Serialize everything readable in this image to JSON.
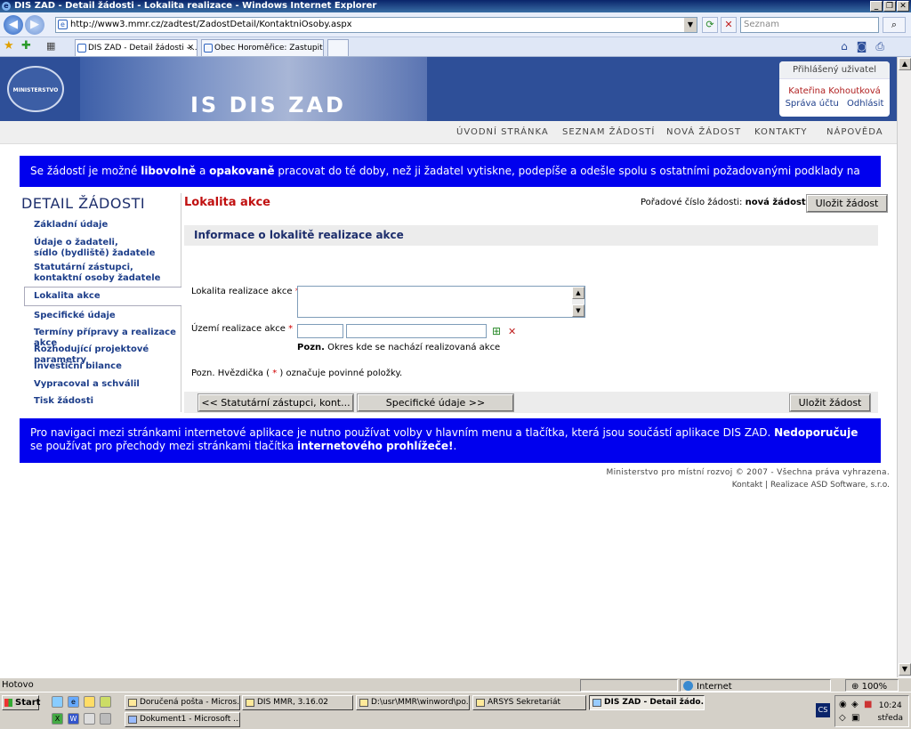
{
  "window": {
    "title": "DIS ZAD - Detail žádosti - Lokalita realizace - Windows Internet Explorer",
    "ie_icon": "e"
  },
  "browser": {
    "url": "http://www3.mmr.cz/zadtest/ZadostDetail/KontaktniOsoby.aspx",
    "search_placeholder": "Seznam",
    "tabs": [
      {
        "label": "DIS ZAD - Detail žádosti -..."
      },
      {
        "label": "Obec Horoměřice: Zastupitel..."
      }
    ],
    "back_glyph": "◀",
    "forward_glyph": "▶",
    "status_left": "Hotovo",
    "status_zone": "Internet",
    "zoom": "100%"
  },
  "header": {
    "seal_text": "MINISTERSTVO PRO MÍSTNÍ ROZVOJ",
    "app_title": "IS DIS ZAD",
    "user_box_title": "Přihlášený uživatel",
    "user_name": "Kateřina Kohoutková",
    "account_link": "Správa účtu",
    "logout_link": "Odhlásit"
  },
  "topnav": [
    "ÚVODNÍ STRÁNKA",
    "SEZNAM ŽÁDOSTÍ",
    "NOVÁ ŽÁDOST",
    "KONTAKTY",
    "NÁPOVĚDA"
  ],
  "info_top": {
    "t1": "Se žádostí je možné ",
    "b1": "libovolně",
    "t2": " a ",
    "b2": "opakovaně",
    "t3": " pracovat do té doby, než ji žadatel vytiskne, podepíše a odešle spolu s ostatními požadovanými podklady na MMR."
  },
  "leftmenu": {
    "title": "DETAIL ŽÁDOSTI",
    "items": [
      {
        "line1": "Základní údaje",
        "line2": ""
      },
      {
        "line1": "Údaje o žadateli,",
        "line2": "sídlo (bydliště) žadatele"
      },
      {
        "line1": "Statutární zástupci,",
        "line2": "kontaktní osoby žadatele"
      },
      {
        "line1": "Lokalita akce",
        "line2": ""
      },
      {
        "line1": "Specifické údaje",
        "line2": ""
      },
      {
        "line1": "Termíny přípravy a realizace akce",
        "line2": ""
      },
      {
        "line1": "Rozhodující projektové parametry",
        "line2": ""
      },
      {
        "line1": "Investiční bilance",
        "line2": ""
      },
      {
        "line1": "Vypracoval a schválil",
        "line2": ""
      },
      {
        "line1": "Tisk žádosti",
        "line2": ""
      }
    ]
  },
  "content": {
    "section_title": "Lokalita akce",
    "seq_label": "Pořadové číslo žádosti:",
    "seq_value": "nová žádost",
    "save_label": "Uložit žádost",
    "info_header": "Informace o lokalitě realizace akce",
    "field1_label": "Lokalita realizace akce",
    "field1_value": "",
    "field2_label": "Území realizace akce",
    "field2_code": "",
    "field2_name": "",
    "required_mark": "*",
    "note_bold": "Pozn.",
    "note_text": " Okres kde se nachází realizovaná akce",
    "hint_before": "Pozn. Hvězdička ( ",
    "hint_after": " ) označuje povinné položky.",
    "prev_button": "<< Statutární zástupci, kont...",
    "next_button": "Specifické údaje >>"
  },
  "info_bottom": {
    "t1": "Pro navigaci mezi stránkami internetové aplikace je nutno používat volby v hlavním menu a tlačítka, která jsou součástí aplikace DIS ZAD. ",
    "b1": "Nedoporučuje",
    "t2": " se používat pro přechody mezi stránkami tlačítka ",
    "b2": "internetového prohlížeče!",
    "t3": "."
  },
  "footer": {
    "copyright": "Ministerstvo pro místní rozvoj © 2007 - Všechna práva vyhrazena.",
    "contact": "Kontakt",
    "sep": "|",
    "vendor": "Realizace ASD Software, s.r.o."
  },
  "taskbar": {
    "start": "Start",
    "tasks_row1": [
      "Doručená pošta - Micros...",
      "DIS MMR, 3.16.02",
      "D:\\usr\\MMR\\winword\\po...",
      "ARSYS Sekretariát",
      "DIS ZAD - Detail žádo..."
    ],
    "tasks_row2": [
      "Dokument1 - Microsoft ..."
    ],
    "tray_lang": "CS",
    "time": "10:24",
    "day": "středa"
  }
}
